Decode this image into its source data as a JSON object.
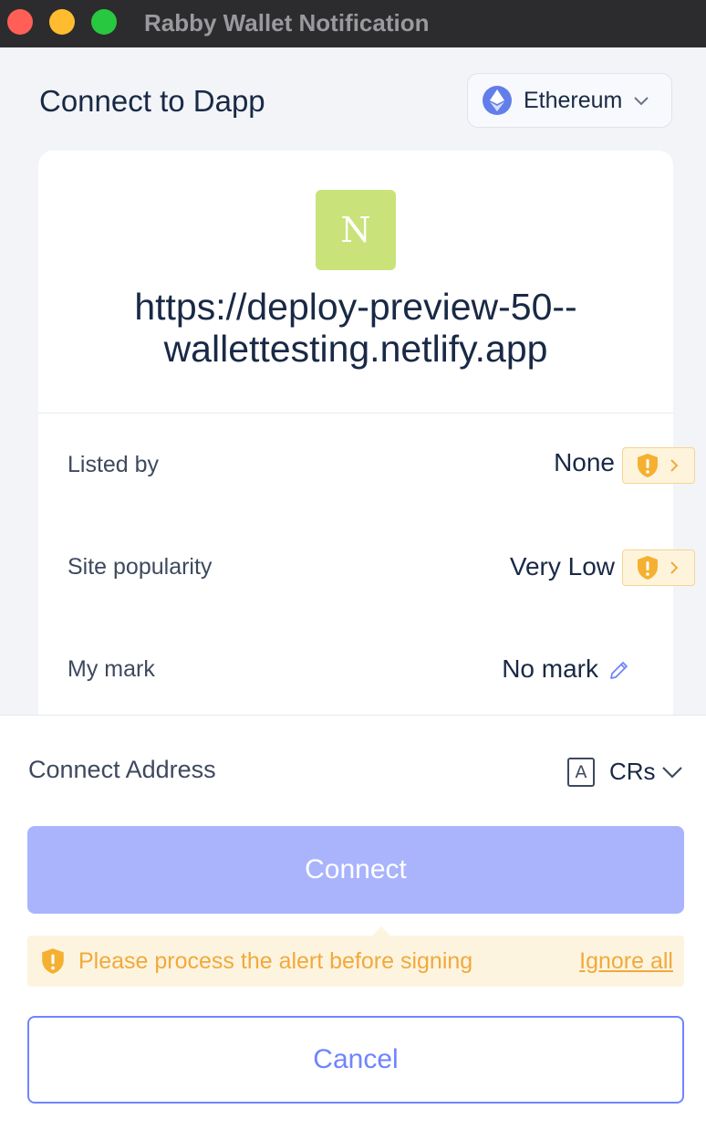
{
  "window": {
    "title": "Rabby Wallet Notification"
  },
  "header": {
    "title": "Connect to Dapp",
    "chain": "Ethereum",
    "chain_icon": "ethereum-icon"
  },
  "dapp": {
    "logo_letter": "N",
    "logo_color": "#c9e37a",
    "url_line1": "https://deploy-preview-50--",
    "url_line2": "wallettesting.netlify.app"
  },
  "security": {
    "listed_by": {
      "label": "Listed by",
      "value": "None"
    },
    "site_popularity": {
      "label": "Site popularity",
      "value": "Very Low"
    },
    "my_mark": {
      "label": "My mark",
      "value": "No mark"
    }
  },
  "address": {
    "label": "Connect Address",
    "type_letter": "A",
    "name": "CRs"
  },
  "actions": {
    "connect_label": "Connect",
    "alert_text": "Please process the alert before signing",
    "ignore_label": "Ignore all",
    "cancel_label": "Cancel"
  },
  "colors": {
    "accent": "#7084ff",
    "warning": "#f2a93b",
    "connect_disabled": "#a9b4fd"
  }
}
